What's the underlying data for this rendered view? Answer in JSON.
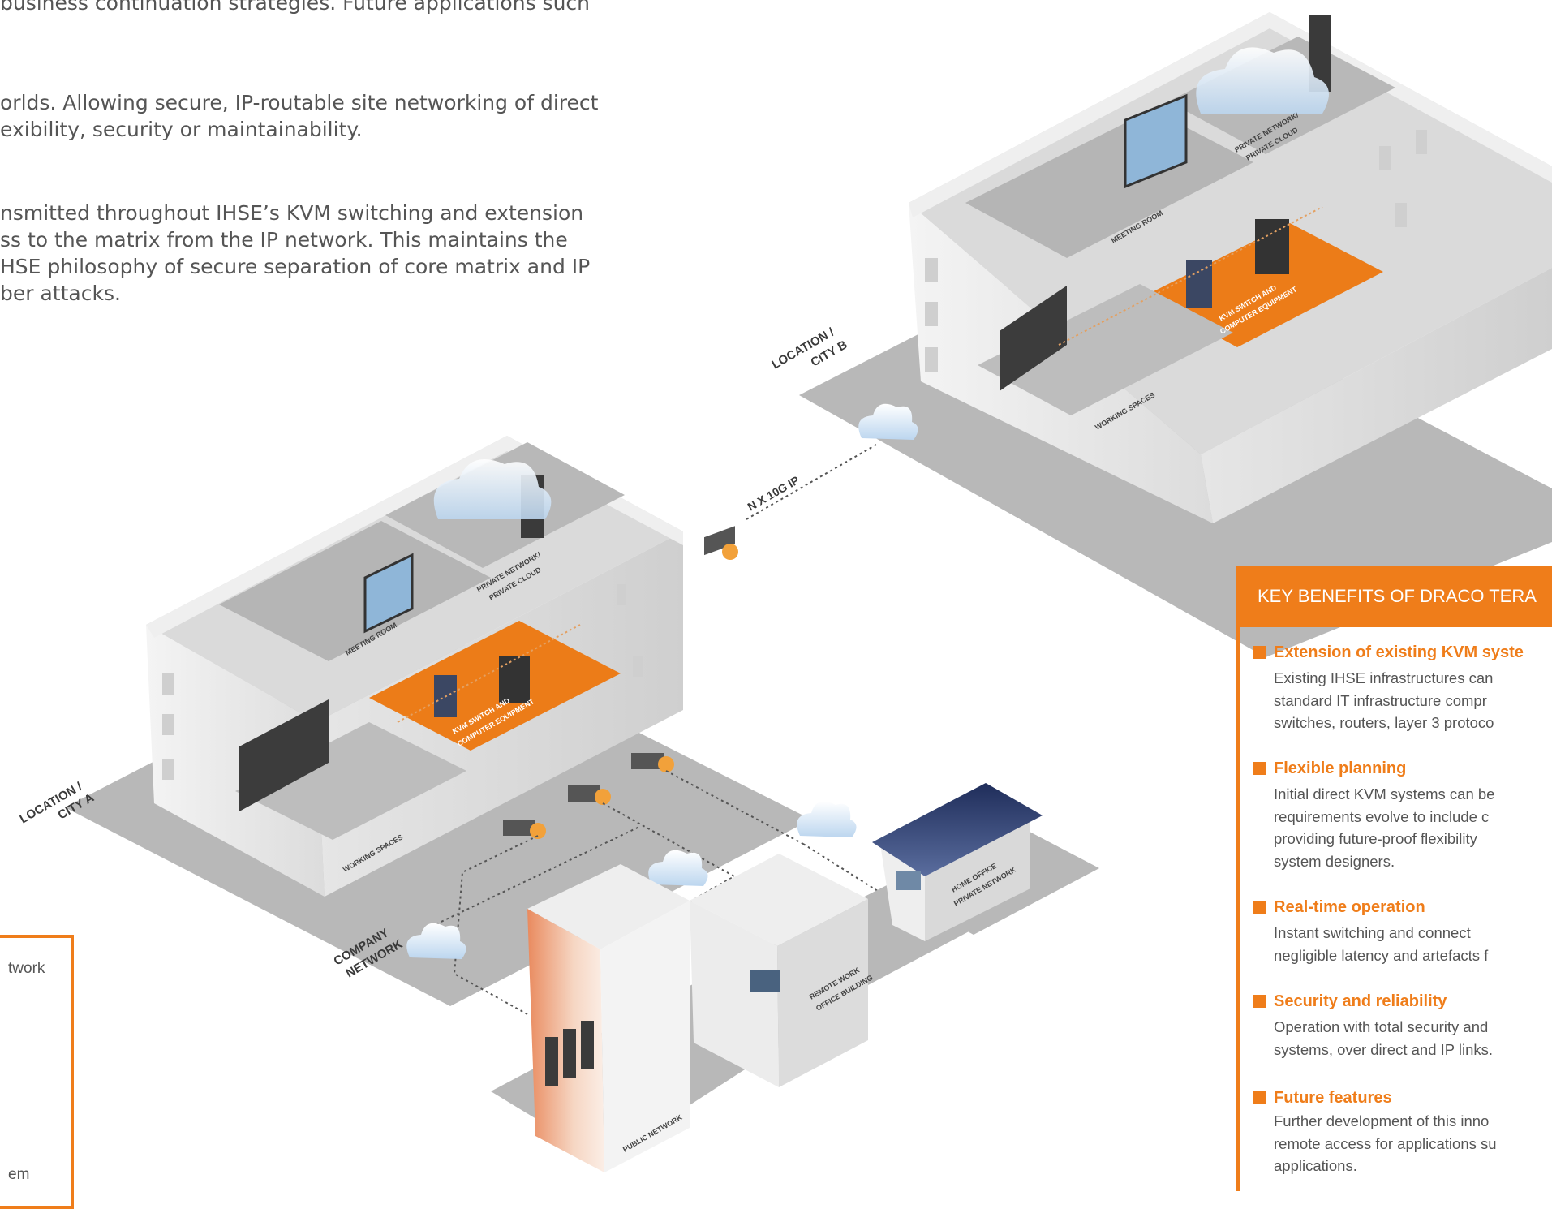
{
  "intro_text": {
    "p1": [
      "business continuation strategies. Future applications such"
    ],
    "p2": [
      "orlds. Allowing secure, IP-routable site networking of direct",
      "exibility, security or maintainability."
    ],
    "p3": [
      "nsmitted throughout IHSE’s KVM switching and extension",
      "ss to the matrix from the IP network. This maintains the",
      "HSE philosophy of secure separation of core matrix and IP",
      "ber attacks."
    ]
  },
  "diagram": {
    "location_b": [
      "LOCATION /",
      "CITY B"
    ],
    "location_a": [
      "LOCATION /",
      "CITY A"
    ],
    "link_label": "N X 10G IP",
    "company_network": [
      "COMPANY",
      "NETWORK"
    ],
    "rooms_b": {
      "meeting": "MEETING ROOM",
      "private": [
        "PRIVATE NETWORK/",
        "PRIVATE CLOUD"
      ],
      "kvm": [
        "KVM SWITCH AND",
        "COMPUTER EQUIPMENT"
      ],
      "working": "WORKING SPACES"
    },
    "rooms_a": {
      "meeting": "MEETING ROOM",
      "private": [
        "PRIVATE NETWORK/",
        "PRIVATE CLOUD"
      ],
      "kvm": [
        "KVM SWITCH AND",
        "COMPUTER EQUIPMENT"
      ],
      "working": "WORKING SPACES"
    },
    "home_office": [
      "HOME OFFICE",
      "PRIVATE NETWORK"
    ],
    "remote_work": [
      "REMOTE WORK",
      "OFFICE BUILDING"
    ],
    "public_network": "PUBLIC NETWORK"
  },
  "benefits": {
    "heading": "KEY BENEFITS OF DRACO TERA",
    "accent_color": "#ef7d1a",
    "items": [
      {
        "title": "Extension of existing KVM syste",
        "lines": [
          "Existing IHSE infrastructures can",
          "standard IT infrastructure compr",
          "switches, routers, layer 3 protoco"
        ]
      },
      {
        "title": "Flexible planning",
        "lines": [
          "Initial direct KVM systems can be",
          "requirements evolve to include c",
          "providing future-proof flexibility",
          "system designers."
        ]
      },
      {
        "title": "Real-time operation",
        "lines": [
          "Instant  switching  and  connect",
          "negligible latency and artefacts f"
        ]
      },
      {
        "title": "Security and reliability",
        "lines": [
          "Operation with total security and",
          "systems, over direct and IP links."
        ]
      },
      {
        "title": "Future features",
        "lines": [
          "Further development of this inno",
          "remote access for applications su",
          "applications."
        ]
      }
    ]
  },
  "left_box": {
    "line1": "twork",
    "line2": "em"
  }
}
